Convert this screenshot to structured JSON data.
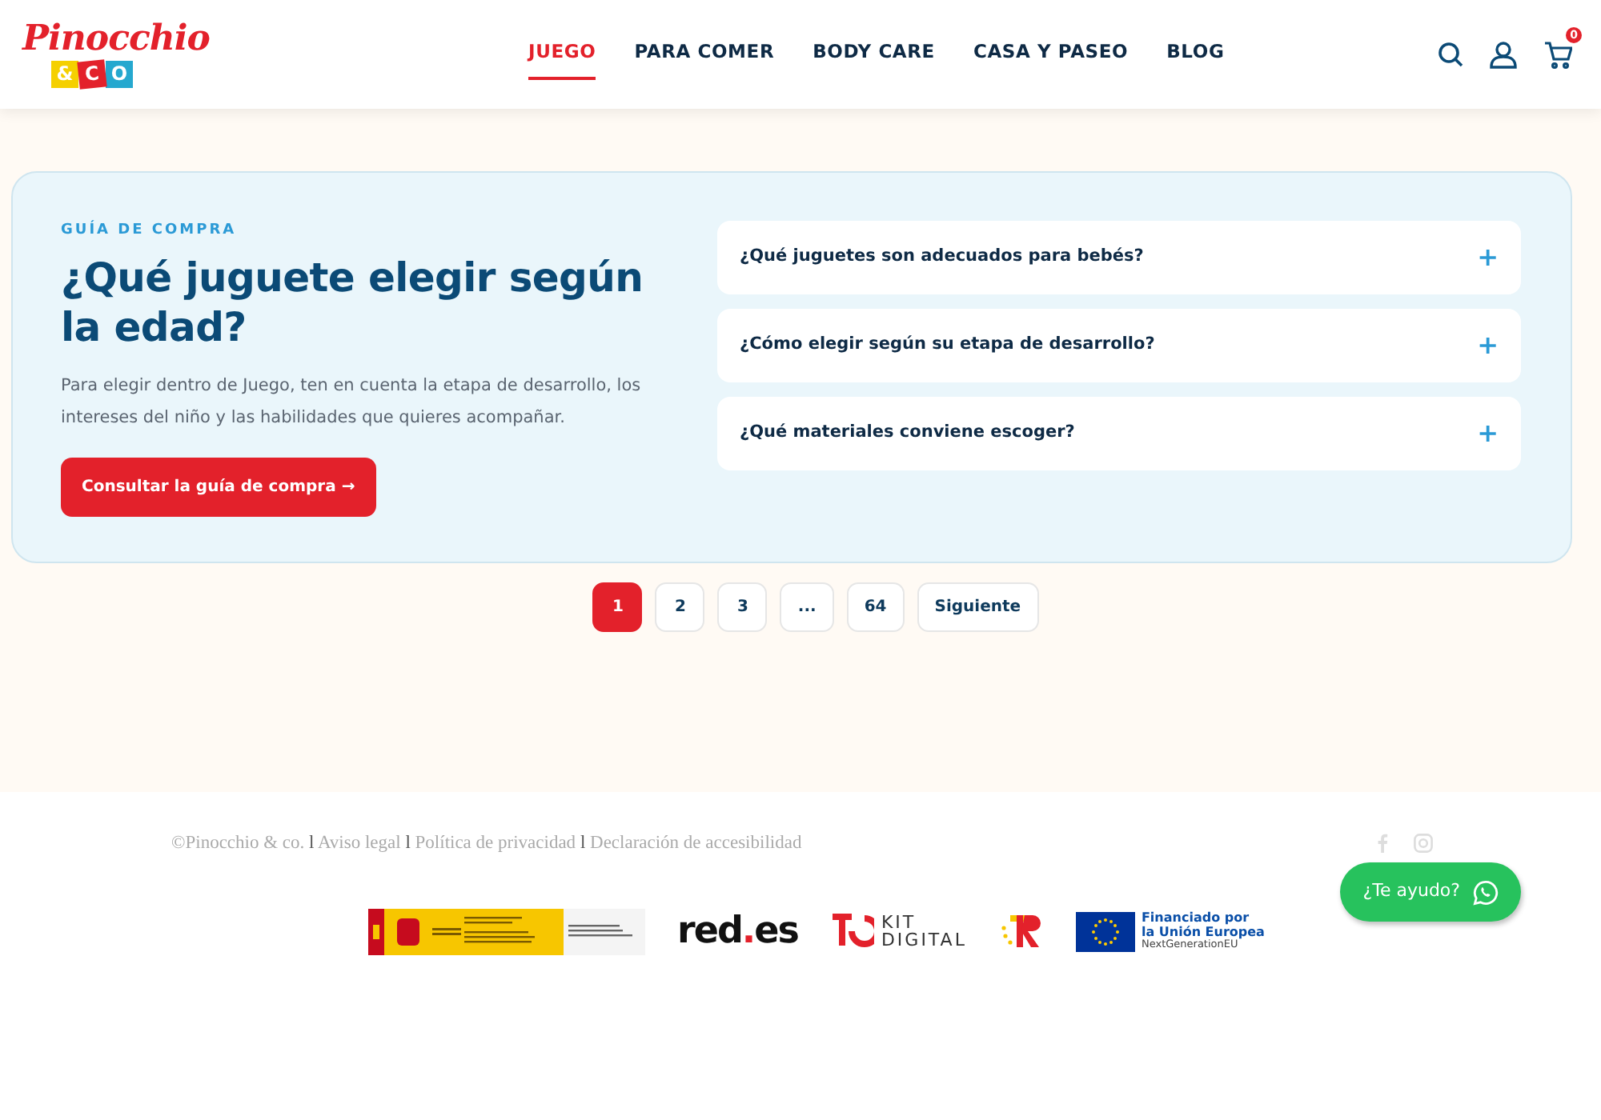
{
  "logo": {
    "script": "Pinocchio",
    "tiles": [
      "&",
      "C",
      "O"
    ]
  },
  "nav": [
    {
      "label": "JUEGO",
      "selected": true
    },
    {
      "label": "PARA COMER",
      "selected": false
    },
    {
      "label": "BODY CARE",
      "selected": false
    },
    {
      "label": "CASA Y PASEO",
      "selected": false
    },
    {
      "label": "BLOG",
      "selected": false
    }
  ],
  "cart_count": "0",
  "guide": {
    "eyebrow": "GUÍA DE COMPRA",
    "title": "¿Qué juguete elegir según la edad?",
    "text": "Para elegir dentro de Juego, ten en cuenta la etapa de desarrollo, los intereses del niño y las habilidades que quieres acompañar.",
    "button": "Consultar la guía de compra →",
    "faq": [
      {
        "question": "¿Qué juguetes son adecuados para bebés?",
        "toggle": "+",
        "expanded": false
      },
      {
        "question": "¿Cómo elegir según su etapa de desarrollo?",
        "toggle": "+",
        "expanded": false
      },
      {
        "question": "¿Qué materiales conviene escoger?",
        "toggle": "+",
        "expanded": false
      }
    ]
  },
  "pagination": [
    {
      "label": "1",
      "selected": true
    },
    {
      "label": "2",
      "selected": false
    },
    {
      "label": "3",
      "selected": false
    },
    {
      "label": "...",
      "selected": false
    },
    {
      "label": "64",
      "selected": false
    },
    {
      "label": "Siguiente",
      "selected": false
    }
  ],
  "footer": {
    "links": [
      "©Pinocchio & co.",
      "Aviso legal",
      "Política de privacidad",
      "Declaración de accesibilidad"
    ],
    "separators": [
      "l",
      "l",
      "l"
    ],
    "sponsors": {
      "redes": [
        "red",
        ".",
        "es"
      ],
      "kit": [
        "KIT",
        "DIGITAL"
      ],
      "eu": [
        "Financiado por",
        "la Unión Europea",
        "NextGenerationEU"
      ]
    }
  },
  "chat_button": "¿Te ayudo?"
}
